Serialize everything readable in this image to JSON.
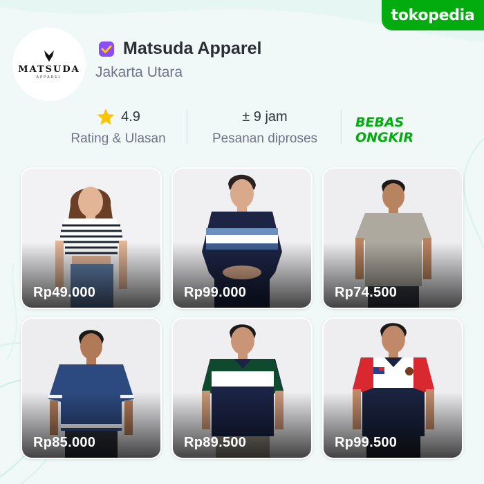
{
  "brand": {
    "name": "tokopedia",
    "color": "#03ac0e"
  },
  "shop": {
    "logo_text": "MATSUDA",
    "logo_subtext": "APPAREL",
    "name": "Matsuda Apparel",
    "location": "Jakarta Utara",
    "verified_icon": "verified-badge-icon",
    "verified_color": "#8c4dff"
  },
  "stats": {
    "rating": {
      "value": "4.9",
      "label": "Rating & Ulasan",
      "icon": "star-icon"
    },
    "processing": {
      "value": "± 9 jam",
      "label": "Pesanan diproses"
    },
    "shipping": {
      "line1": "BEBAS",
      "line2": "ONGKIR",
      "color": "#03ac0e"
    }
  },
  "products": [
    {
      "price": "Rp49.000",
      "description": "women striped crop tee",
      "shirt_color": "#ffffff",
      "stripe_color": "#1d2733",
      "skin": "#e3b596",
      "hair": "#6b3f25"
    },
    {
      "price": "Rp99.000",
      "description": "navy long sleeve with blue panels",
      "shirt_color": "#1d2545",
      "stripe_color": "#6c8fc2",
      "skin": "#d8a98a",
      "hair": "#2a2120"
    },
    {
      "price": "Rp74.500",
      "description": "grey crew tee",
      "shirt_color": "#aea99f",
      "stripe_color": "#aea99f",
      "skin": "#b8835f",
      "hair": "#1e1a18"
    },
    {
      "price": "Rp85.000",
      "description": "blue oversized tee",
      "shirt_color": "#2c4a80",
      "stripe_color": "#ffffff",
      "skin": "#b07a58",
      "hair": "#1c1816"
    },
    {
      "price": "Rp89.500",
      "description": "green white navy polo",
      "shirt_color": "#1b2446",
      "stripe_color": "#0f4a2e",
      "skin": "#c89576",
      "hair": "#1d1917"
    },
    {
      "price": "Rp99.500",
      "description": "red white navy polo with flag",
      "shirt_color": "#1a2340",
      "stripe_color": "#d9282f",
      "skin": "#c08a6a",
      "hair": "#1b1715"
    }
  ]
}
